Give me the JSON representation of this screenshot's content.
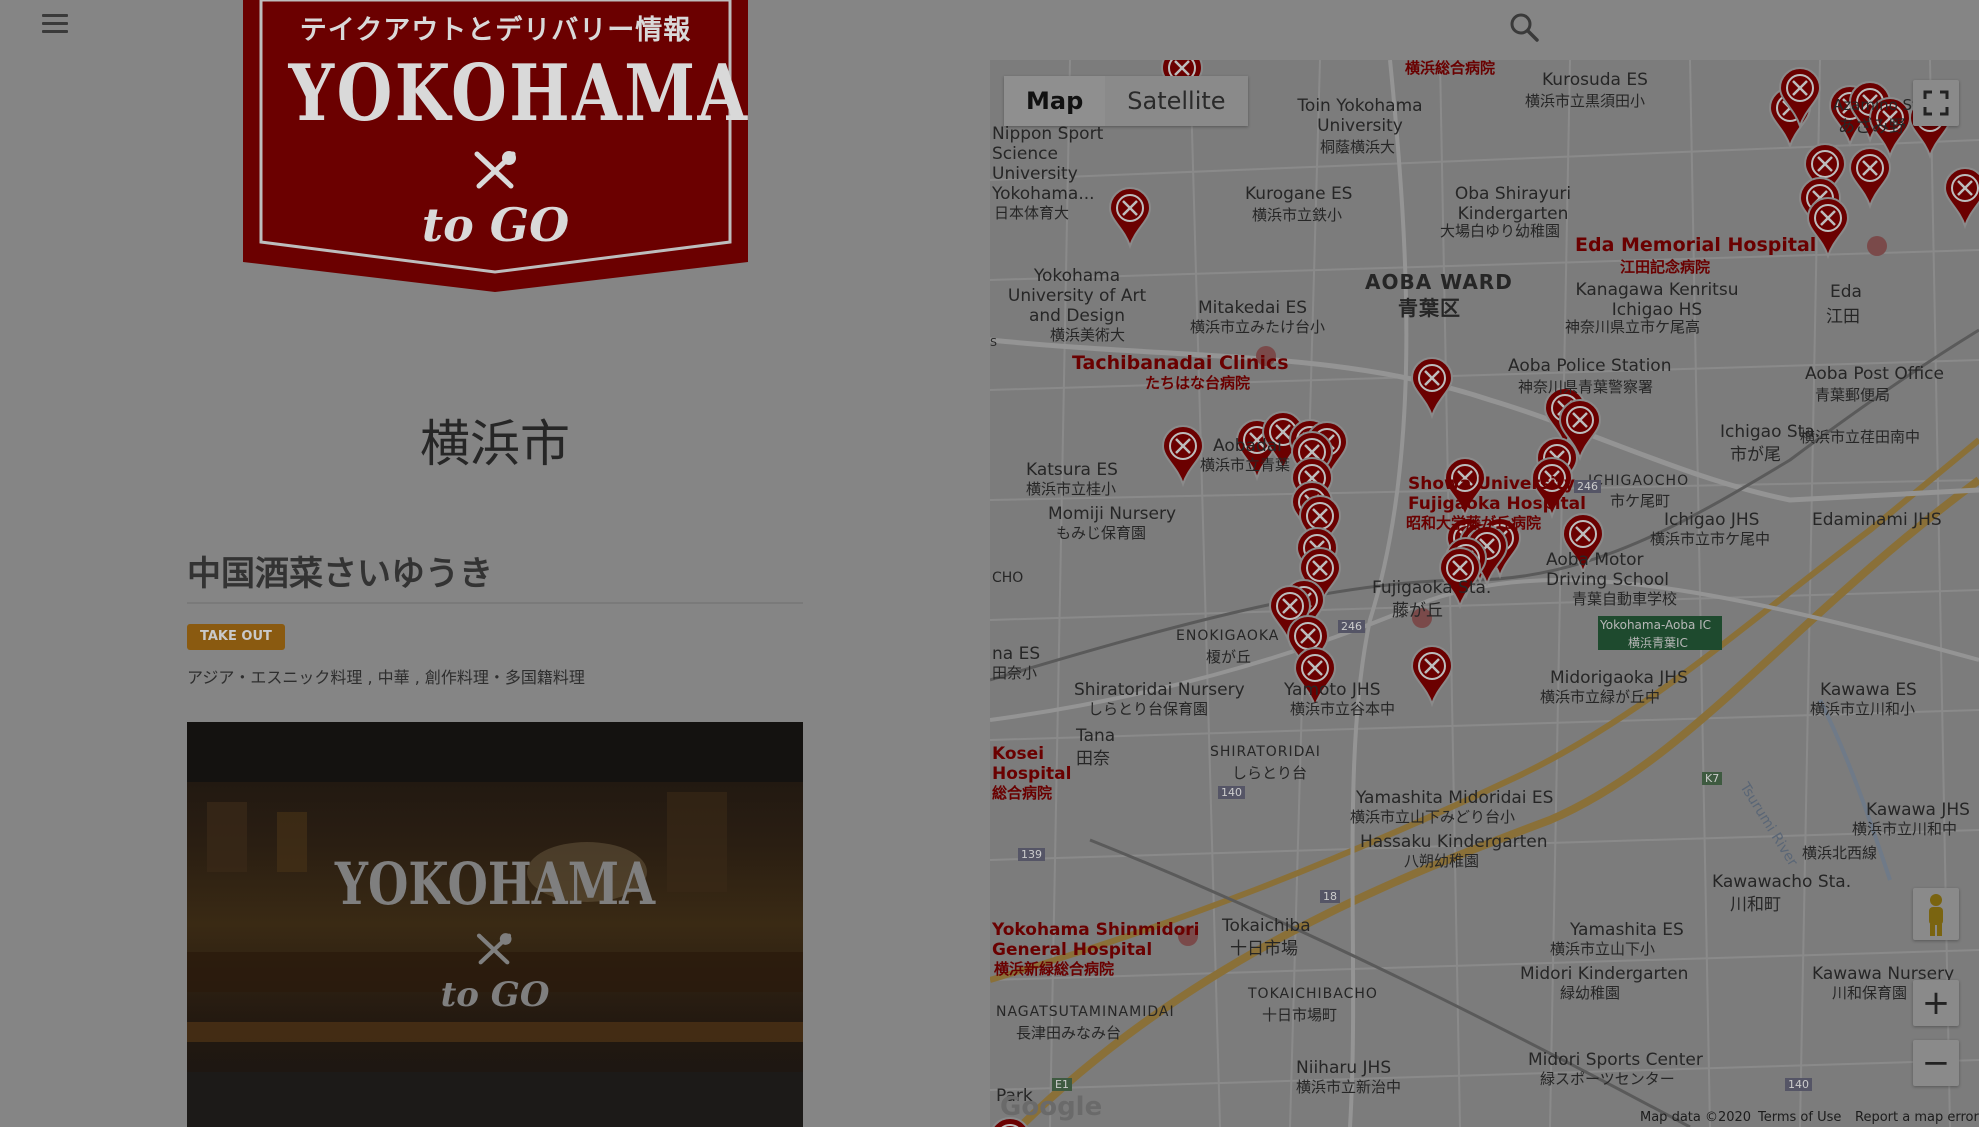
{
  "header": {
    "menu_icon": "hamburger-menu-icon",
    "search_icon": "search-icon"
  },
  "logo": {
    "top_text": "テイクアウトとデリバリー情報",
    "main_text": "YOKOHAMA",
    "sub_text": "to GO",
    "icon": "fork-knife-icon",
    "banner_color": "#6b0000"
  },
  "page": {
    "city": "横浜市",
    "shop_title": "中国酒菜さいゆうき",
    "badge": "TAKE OUT",
    "badge_color": "#8a5a10",
    "tags": "アジア・エスニック料理 , 中華 , 創作料理・多国籍料理",
    "photo_overlay_main": "YOKOHAMA",
    "photo_overlay_sub": "to GO"
  },
  "map": {
    "type_map": "Map",
    "type_satellite": "Satellite",
    "fullscreen_icon": "fullscreen-icon",
    "pegman_icon": "street-view-pegman-icon",
    "zoom_in": "+",
    "zoom_out": "−",
    "google_logo": "Google",
    "footer": {
      "data": "Map data ©2020",
      "terms": "Terms of Use",
      "report": "Report a map error"
    },
    "pin_color": "#6b0000",
    "labels": {
      "yokohama_hospital": "横浜総合病院",
      "kurosuda_es": "Kurosuda ES",
      "kurosuda_es_jp": "横浜市立黒須田小",
      "toin_univ": "Toin Yokohama University",
      "toin_univ_jp": "桐蔭横浜大",
      "nippon_sport": "Nippon Sport Science University Yokohama...",
      "nippon_sport_jp": "日本体育大",
      "kurogane_es": "Kurogane ES",
      "kurogane_es_jp": "横浜市立鉄小",
      "oba_shirayuri": "Oba Shirayuri Kindergarten",
      "oba_shirayuri_jp": "大場白ゆり幼稚園",
      "azamino": "Azamino Sta.",
      "azamino_jp": "あざみ野",
      "eda_hospital": "Eda Memorial Hospital",
      "eda_hospital_jp": "江田記念病院",
      "eda": "Eda",
      "eda_jp": "江田",
      "aoba_ward": "AOBA WARD",
      "aoba_ward_jp": "青葉区",
      "yokohama_art": "Yokohama University of Art and Design",
      "yokohama_art_jp": "横浜美術大",
      "mitakedai": "Mitakedai ES",
      "mitakedai_jp": "横浜市立みたけ台小",
      "kanagawa_kenritsu": "Kanagawa Kenritsu Ichigao HS",
      "kanagawa_kenritsu_jp": "神奈川県立市ケ尾高",
      "tachibanadai": "Tachibanadai Clinics",
      "tachibanadai_jp": "たちはな台病院",
      "aoba_police": "Aoba Police Station",
      "aoba_police_jp": "神奈川県青葉警察署",
      "aoba_post": "Aoba Post Office",
      "aoba_post_jp": "青葉郵便局",
      "ichigao_sta": "Ichigao Sta.",
      "ichigao_sta_jp": "市が尾",
      "ichigaocho": "ICHIGAOCHO",
      "ichigaocho_jp": "市ケ尾町",
      "ichigao_jhs": "Ichigao JHS",
      "ichigao_jhs_jp": "横浜市立市ケ尾中",
      "aobadai": "Aobadai",
      "aobadai_jp": "横浜市立青葉",
      "katsura_es": "Katsura ES",
      "katsura_es_jp": "横浜市立桂小",
      "momiji": "Momiji Nursery",
      "momiji_jp": "もみじ保育園",
      "showa_univ": "Showa University Fujigaoka Hospital",
      "showa_univ_jp": "昭和大学藤が丘病院",
      "edaminami": "Edaminami JHS",
      "edaminami_jp": "横浜市立荏田南中",
      "aoba_motor": "Aoba Motor Driving School",
      "aoba_motor_jp": "青葉自動車学校",
      "fujigaoka": "Fujigaoka Sta.",
      "fujigaoka_jp": "藤が丘",
      "ic_sign": "Yokohama-Aoba IC",
      "ic_sign_jp": "横浜青葉IC",
      "enokigaoka": "ENOKIGAOKA",
      "enokigaoka_jp": "榎が丘",
      "midorigaoka": "Midorigaoka JHS",
      "midorigaoka_jp": "横浜市立緑が丘中",
      "kawawa_es": "Kawawa ES",
      "kawawa_es_jp": "横浜市立川和小",
      "shiratoridai_nursery": "Shiratoridai Nursery",
      "shiratoridai_nursery_jp": "しらとり台保育園",
      "yamoto": "Yamoto JHS",
      "yamoto_jp": "横浜市立谷本中",
      "tana": "Tana",
      "tana_jp": "田奈",
      "shiratoridai": "SHIRATORIDAI",
      "shiratoridai_jp": "しらとり台",
      "kosei": "Kosei Hospital",
      "kosei_jp": "総合病院",
      "yamashita_midoridai": "Yamashita Midoridai ES",
      "yamashita_midoridai_jp": "横浜市立山下みどり台小",
      "tsurumi_river": "Tsurumi River",
      "kawawa_jhs": "Kawawa JHS",
      "kawawa_jhs_jp": "横浜市立川和中",
      "hassaku": "Hassaku Kindergarten",
      "hassaku_jp": "八朔幼稚園",
      "yokohama_kitanishi": "横浜北西線",
      "kawawacho": "Kawawacho Sta.",
      "kawawacho_jp": "川和町",
      "shinmidori": "Yokohama Shinmidori General Hospital",
      "shinmidori_jp": "横浜新緑総合病院",
      "tokaichiba": "Tokaichiba",
      "tokaichiba_jp": "十日市場",
      "yamashita_es": "Yamashita ES",
      "yamashita_es_jp": "横浜市立山下小",
      "midori_kinder": "Midori Kindergarten",
      "midori_kinder_jp": "緑幼稚園",
      "kawawa_nursery": "Kawawa Nursery",
      "kawawa_nursery_jp": "川和保育園",
      "tokaichibacho": "TOKAICHIBACHO",
      "tokaichibacho_jp": "十日市場町",
      "nagatsuta": "NAGATSUTAMINAMIDAI",
      "nagatsuta_jp": "長津田みなみ台",
      "niiharu": "Niiharu JHS",
      "niiharu_jp": "横浜市立新治中",
      "midori_sports": "Midori Sports Center",
      "midori_sports_jp": "緑スポーツセンター",
      "park": "Park",
      "cho": "CHO",
      "na_es": "na ES",
      "na_es_jp": "田奈小",
      "route_246a": "246",
      "route_246b": "246",
      "route_140a": "140",
      "route_140b": "140",
      "route_139": "139",
      "route_18": "18",
      "route_k7": "K7",
      "route_e1": "E1",
      "route_s": "S"
    }
  }
}
